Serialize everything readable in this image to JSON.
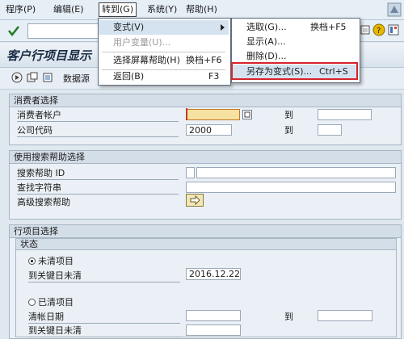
{
  "menubar": {
    "items": [
      {
        "label": "程序(P)"
      },
      {
        "label": "编辑(E)"
      },
      {
        "label": "转到(G)"
      },
      {
        "label": "系统(Y)"
      },
      {
        "label": "帮助(H)"
      }
    ]
  },
  "page": {
    "title": "客户行项目显示",
    "apptoolbar_text": "数据源"
  },
  "goto_menu": {
    "items": [
      {
        "label": "变式(V)"
      },
      {
        "label": "用户变量(U)..."
      },
      {
        "label": "选择屏幕帮助(H)",
        "shortcut": "换档+F6"
      },
      {
        "label": "返回(B)",
        "shortcut": "F3"
      }
    ]
  },
  "variant_menu": {
    "items": [
      {
        "label": "选取(G)...",
        "shortcut": "换档+F5"
      },
      {
        "label": "显示(A)..."
      },
      {
        "label": "删除(D)..."
      },
      {
        "label": "另存为变式(S)...",
        "shortcut": "Ctrl+S"
      }
    ]
  },
  "customer_selection": {
    "title": "消费者选择",
    "to_label": "到",
    "account_label": "消费者帐户",
    "account_value": "",
    "company_label": "公司代码",
    "company_value": "2000"
  },
  "search_help": {
    "title": "使用搜索帮助选择",
    "id_label": "搜索帮助 ID",
    "string_label": "查找字符串",
    "advanced_label": "高级搜索帮助"
  },
  "line_items": {
    "title": "行项目选择",
    "status_title": "状态",
    "open_items_label": "未清项目",
    "open_key_date_label": "到关键日未清",
    "open_key_date_value": "2016.12.22",
    "cleared_items_label": "已清项目",
    "clearing_date_label": "清帐日期",
    "cleared_key_date_label": "到关键日未清",
    "to_label": "到"
  }
}
